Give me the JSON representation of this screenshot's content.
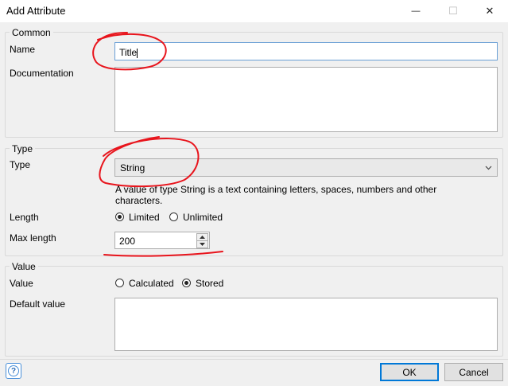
{
  "window": {
    "title": "Add Attribute",
    "minimize_glyph": "—",
    "maximize_glyph": "☐",
    "close_glyph": "✕"
  },
  "common": {
    "legend": "Common",
    "name_label": "Name",
    "name_value": "Title",
    "documentation_label": "Documentation",
    "documentation_value": ""
  },
  "type_section": {
    "legend": "Type",
    "type_label": "Type",
    "type_value": "String",
    "description_line1": "A value of type String is a text containing letters, spaces, numbers and other",
    "description_line2": "characters.",
    "length_label": "Length",
    "length_options": [
      "Limited",
      "Unlimited"
    ],
    "length_selected": "Limited",
    "max_length_label": "Max length",
    "max_length_value": "200"
  },
  "value_section": {
    "legend": "Value",
    "value_label": "Value",
    "value_options": [
      "Calculated",
      "Stored"
    ],
    "value_selected": "Stored",
    "default_value_label": "Default value",
    "default_value": ""
  },
  "footer": {
    "help_glyph": "?",
    "ok_label": "OK",
    "cancel_label": "Cancel"
  },
  "annotation_color": "#e8141c"
}
